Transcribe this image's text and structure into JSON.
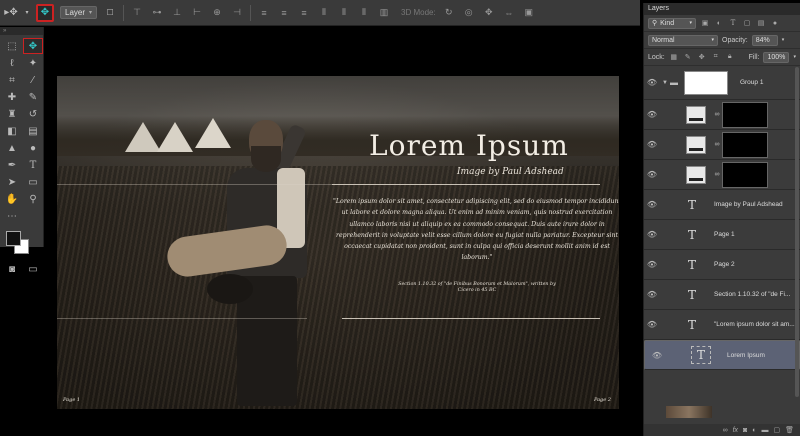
{
  "options_bar": {
    "auto_select_dropdown": "Layer",
    "mode_3d_label": "3D Mode:"
  },
  "toolbox": {
    "tools": [
      "marquee-icon",
      "move-icon",
      "lasso-icon",
      "magic-wand-icon",
      "crop-icon",
      "eyedropper-icon",
      "healing-brush-icon",
      "brush-icon",
      "stamp-icon",
      "history-brush-icon",
      "eraser-icon",
      "gradient-icon",
      "blur-icon",
      "dodge-icon",
      "pen-icon",
      "type-icon",
      "path-select-icon",
      "shape-icon",
      "hand-icon",
      "zoom-icon"
    ],
    "foreground_color": "#111111",
    "background_color": "#ffffff"
  },
  "document": {
    "title": "Lorem Ipsum",
    "subtitle": "Image by Paul Adshead",
    "body": "\"Lorem ipsum dolor sit amet, consectetur adipiscing elit, sed do eiusmod tempor incididunt ut labore et dolore magna aliqua. Ut enim ad minim veniam, quis nostrud exercitation ullamco laboris nisi ut aliquip ex ea commodo consequat. Duis aute irure dolor in reprehenderit in voluptate velit esse cillum dolore eu fugiat nulla pariatur. Excepteur sint occaecat cupidatat non proident, sunt in culpa qui officia deserunt mollit anim id est laborum.\"",
    "citation": "Section 1.10.32 of \"de Finibus Bonorum et Malorum\", written by Cicero in 45 BC",
    "page_left": "Page 1",
    "page_right": "Page 2"
  },
  "layers_panel": {
    "tab": "Layers",
    "filter_kind": "Kind",
    "blend_mode": "Normal",
    "opacity_label": "Opacity:",
    "opacity_value": "84%",
    "lock_label": "Lock:",
    "fill_label": "Fill:",
    "fill_value": "100%",
    "group_name": "Group 1",
    "text_layers": [
      "Image by Paul Adshead",
      "Page 1",
      "Page 2",
      "Section 1.10.32 of \"de Fi...",
      "\"Lorem ipsum dolor sit am...",
      "Lorem Ipsum"
    ],
    "selected_layer": "Lorem Ipsum",
    "selection_color": "#5c6275"
  }
}
